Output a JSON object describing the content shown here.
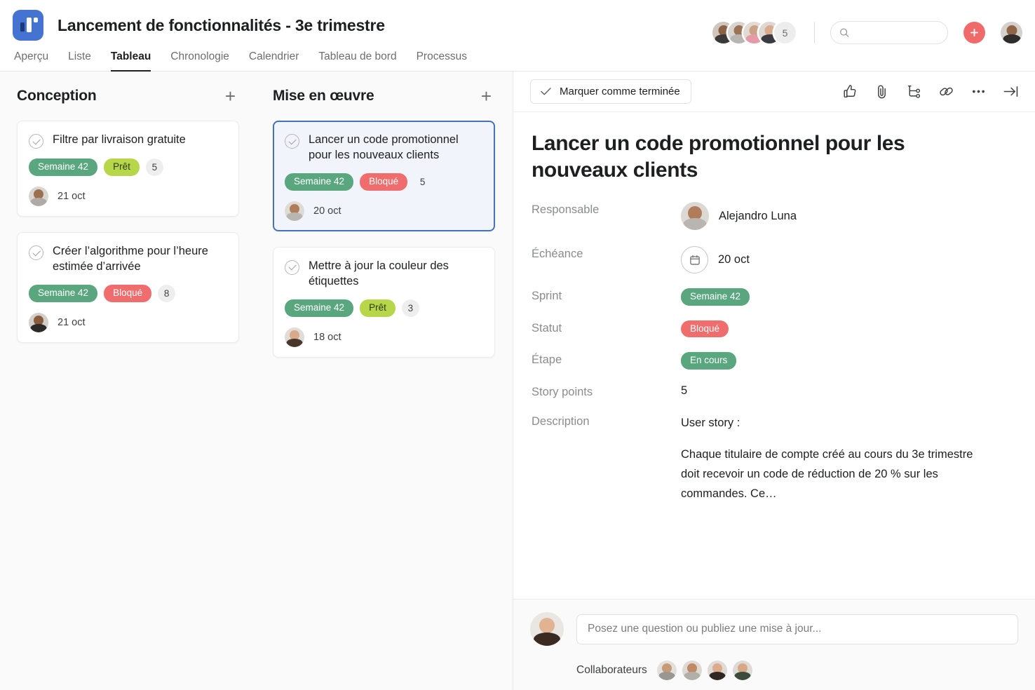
{
  "header": {
    "logo_icon": "board-logo-icon",
    "board_title": "Lancement de fonctionnalités - 3e trimestre",
    "tabs": [
      {
        "label": "Aperçu",
        "active": false
      },
      {
        "label": "Liste",
        "active": false
      },
      {
        "label": "Tableau",
        "active": true
      },
      {
        "label": "Chronologie",
        "active": false
      },
      {
        "label": "Calendrier",
        "active": false
      },
      {
        "label": "Tableau de bord",
        "active": false
      },
      {
        "label": "Processus",
        "active": false
      }
    ],
    "member_count_badge": "5",
    "search": {
      "value": "",
      "placeholder": "",
      "icon": "search-icon"
    },
    "add_button_icon": "plus-icon",
    "accent_color": "#4573d2",
    "add_button_color": "#f06a6a"
  },
  "board": {
    "columns": [
      {
        "title": "Conception",
        "add_icon": "plus-icon",
        "cards": [
          {
            "title": "Filtre par livraison gratuite",
            "sprint_tag": "Semaine 42",
            "status_tag": "Prêt",
            "status_kind": "ready",
            "points": "5",
            "date": "21 oct",
            "selected": false
          },
          {
            "title": "Créer l’algorithme pour l’heure estimée d’arrivée",
            "sprint_tag": "Semaine 42",
            "status_tag": "Bloqué",
            "status_kind": "blocked",
            "points": "8",
            "date": "21 oct",
            "selected": false
          }
        ]
      },
      {
        "title": "Mise en œuvre",
        "add_icon": "plus-icon",
        "cards": [
          {
            "title": "Lancer un code promotionnel pour les nouveaux clients",
            "sprint_tag": "Semaine 42",
            "status_tag": "Bloqué",
            "status_kind": "blocked",
            "points": "5",
            "date": "20 oct",
            "selected": true
          },
          {
            "title": "Mettre à jour la couleur des étiquettes",
            "sprint_tag": "Semaine 42",
            "status_tag": "Prêt",
            "status_kind": "ready",
            "points": "3",
            "date": "18 oct",
            "selected": false
          }
        ]
      }
    ],
    "tag_colors": {
      "sprint": "#5aa67f",
      "blocked": "#ef6d6d",
      "ready": "#b8d64a"
    }
  },
  "detail": {
    "mark_done_label": "Marquer comme terminée",
    "mark_done_icon": "check-icon",
    "toolbar_icons": [
      "thumbs-up-icon",
      "paperclip-icon",
      "subtask-icon",
      "link-icon",
      "more-options-icon",
      "collapse-panel-icon"
    ],
    "task_title": "Lancer un code promotionnel pour les nouveaux clients",
    "fields": {
      "assignee_label": "Responsable",
      "assignee_name": "Alejandro Luna",
      "due_label": "Échéance",
      "due_value": "20 oct",
      "due_icon": "calendar-icon",
      "sprint_label": "Sprint",
      "sprint_value": "Semaine 42",
      "status_label": "Statut",
      "status_value": "Bloqué",
      "stage_label": "Étape",
      "stage_value": "En cours",
      "points_label": "Story points",
      "points_value": "5",
      "description_label": "Description",
      "description_line1": "User story :",
      "description_line2": "Chaque titulaire de compte créé au cours du 3e trimestre doit recevoir un code de réduction de 20 % sur les commandes. Ce…"
    },
    "comment": {
      "placeholder": "Posez une question ou publiez une mise à jour...",
      "value": ""
    },
    "collaborators_label": "Collaborateurs"
  }
}
